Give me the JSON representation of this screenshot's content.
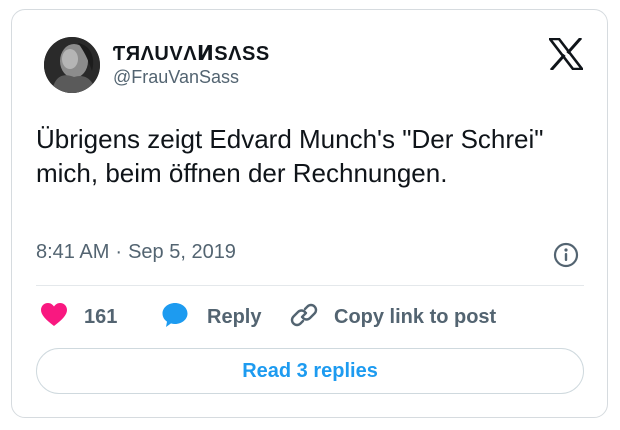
{
  "author": {
    "display_name": "ƬЯΛUVΛͶSΛSS",
    "handle": "@FrauVanSass"
  },
  "tweet": {
    "text": "Übrigens zeigt Edvard Munch's \"Der Schrei\" mich, beim öffnen der Rechnungen.",
    "time": "8:41 AM",
    "separator": "·",
    "date": "Sep 5, 2019"
  },
  "actions": {
    "like_count": "161",
    "reply_label": "Reply",
    "copy_label": "Copy link to post"
  },
  "read_replies_label": "Read 3 replies",
  "icons": {
    "brand": "x-logo-icon",
    "like": "heart-icon",
    "reply": "speech-bubble-icon",
    "copy": "link-icon",
    "info": "info-icon"
  },
  "colors": {
    "like": "#f91880",
    "reply": "#1d9bf0",
    "link_text": "#1d9bf0",
    "secondary_text": "#536471",
    "border": "#cfd9de"
  }
}
